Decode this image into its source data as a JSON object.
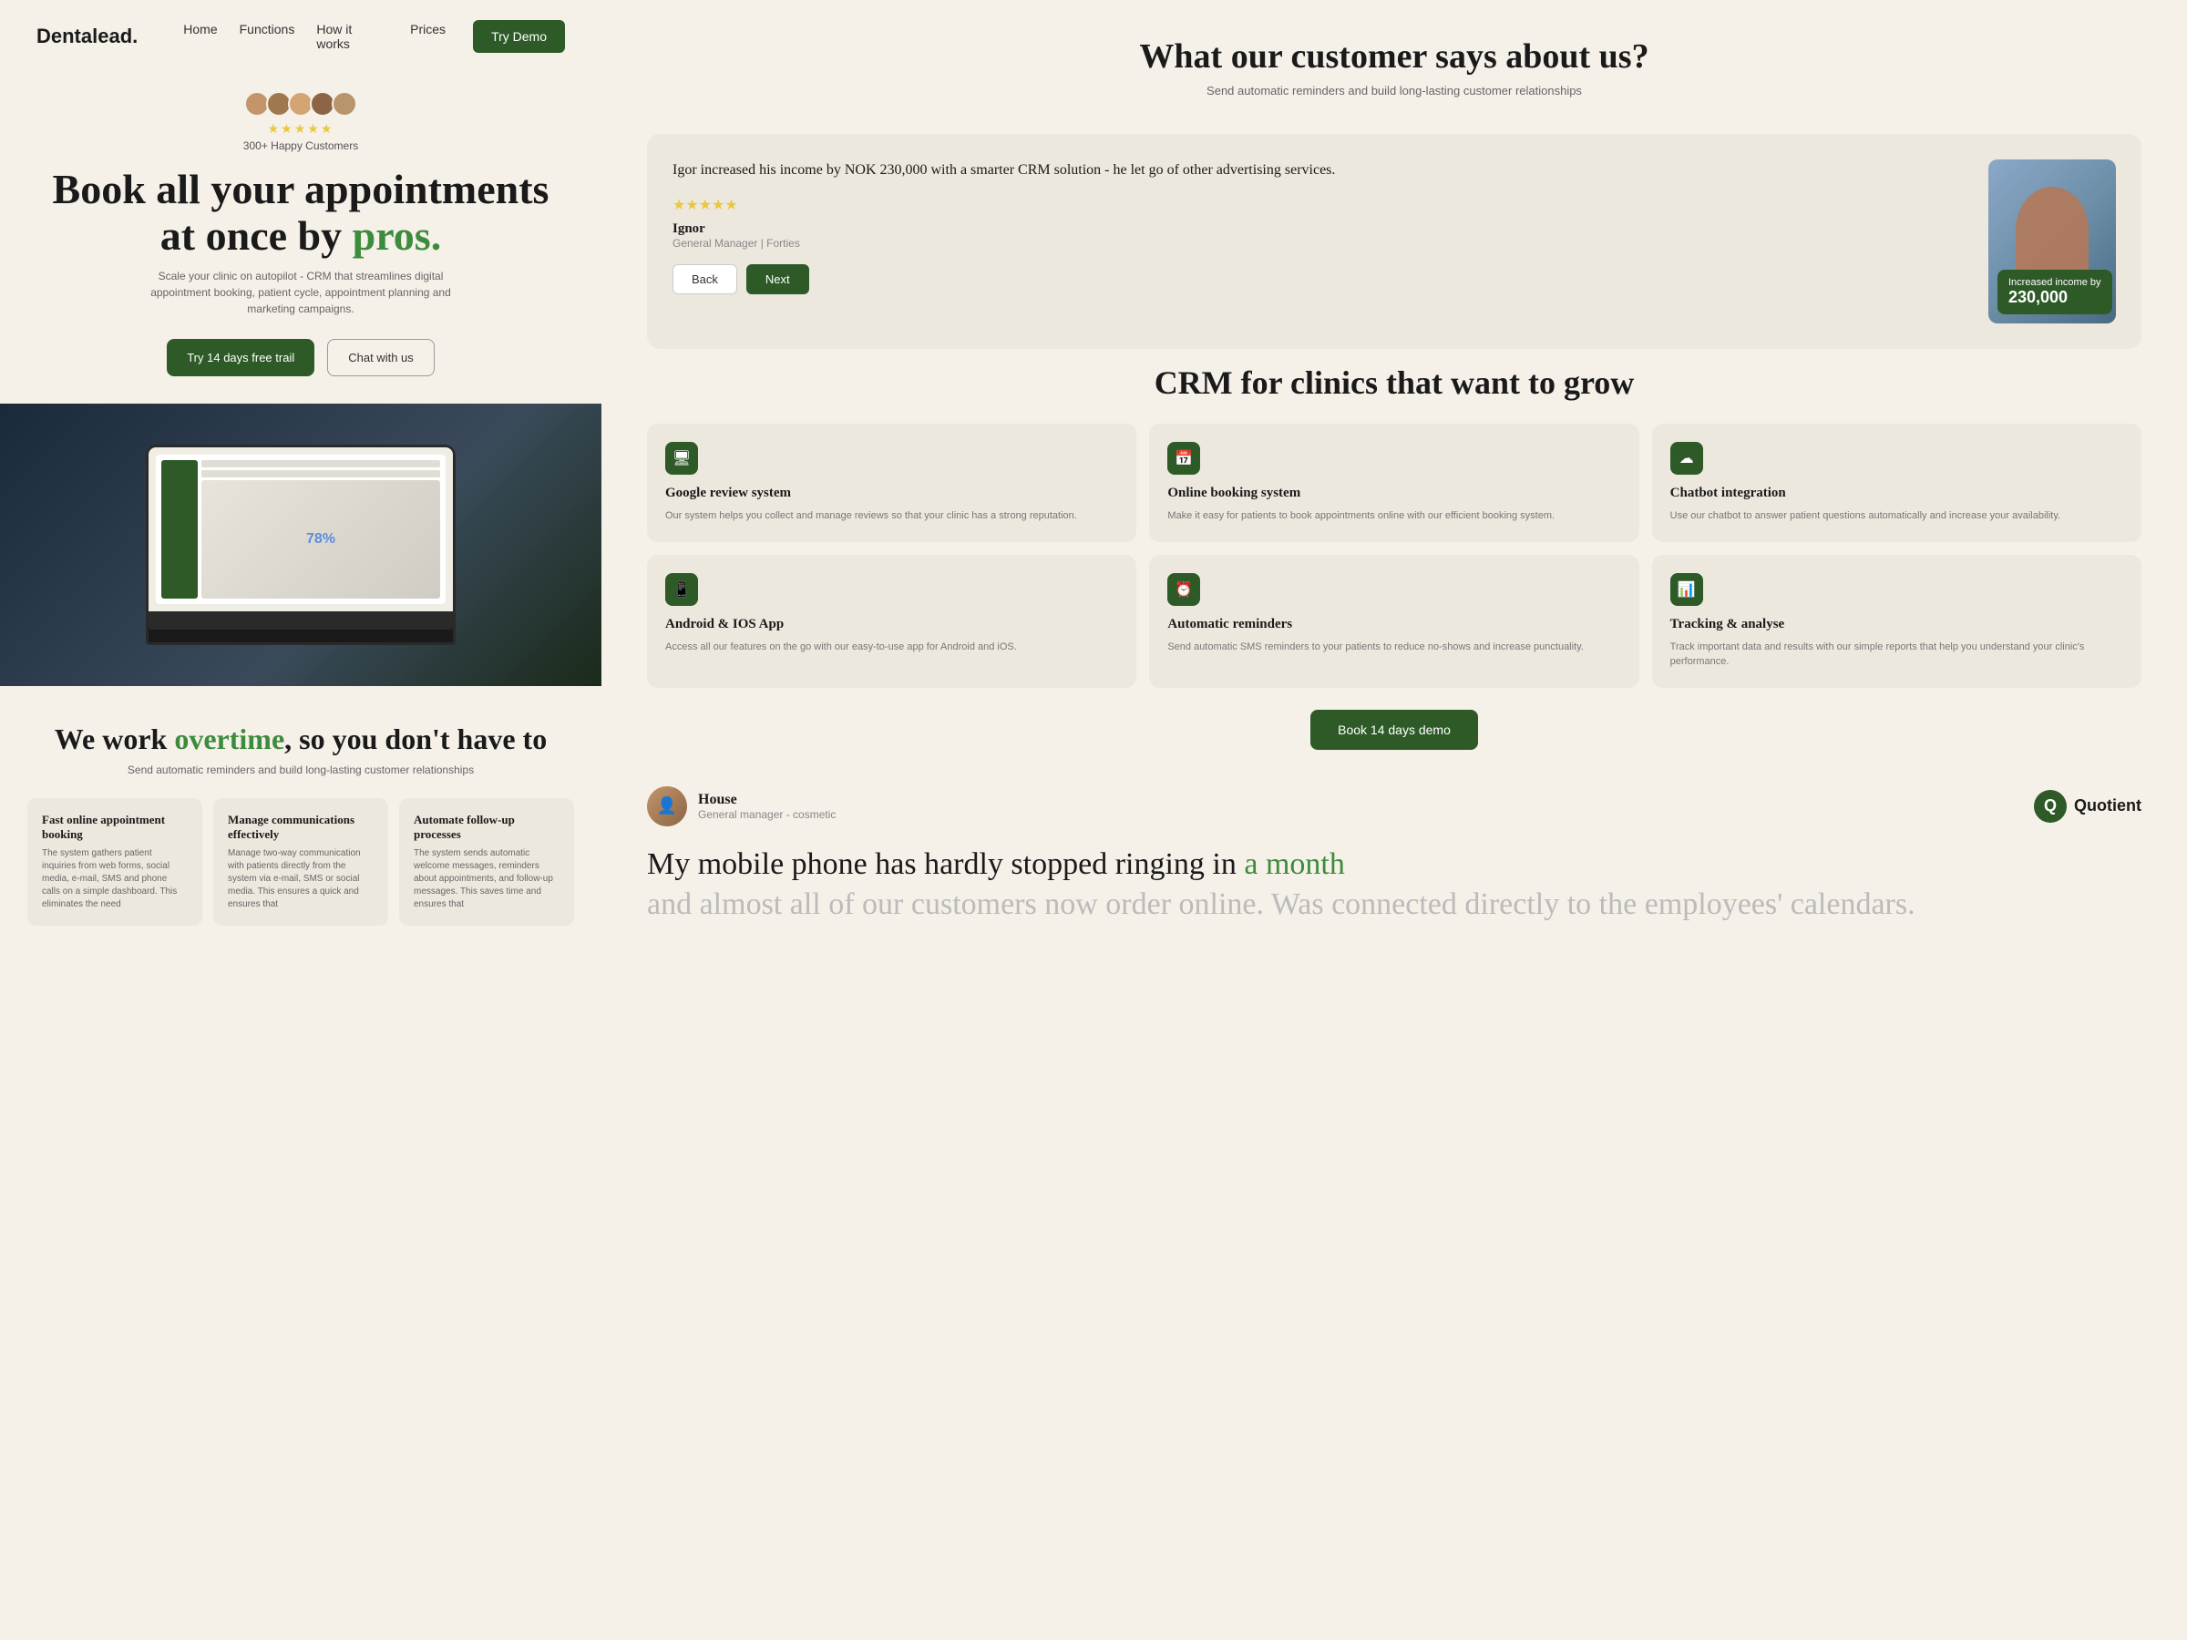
{
  "leftPanel": {
    "nav": {
      "logo": "Dentalead.",
      "links": [
        "Home",
        "Functions",
        "How it works",
        "Prices"
      ],
      "tryBtn": "Try Demo"
    },
    "hero": {
      "avatarCount": 5,
      "stars": "★★★★★",
      "happyCustomers": "300+ Happy Customers",
      "titleLine1": "Book all your appointments",
      "titleLine2": "at once by ",
      "titleAccent": "pros.",
      "subtitle": "Scale your clinic on autopilot - CRM that streamlines digital appointment booking, patient cycle, appointment planning and marketing campaigns.",
      "btnPrimary": "Try 14 days free trail",
      "btnSecondary": "Chat with us"
    },
    "workSection": {
      "title1": "We work ",
      "titleAccent": "overtime",
      "title2": ", so you don't have to",
      "subtitle": "Send automatic reminders and build long-lasting customer relationships",
      "features": [
        {
          "title": "Fast online appointment booking",
          "desc": "The system gathers patient inquiries from web forms, social media, e-mail, SMS and phone calls on a simple dashboard. This eliminates the need"
        },
        {
          "title": "Manage communications effectively",
          "desc": "Manage two-way communication with patients directly from the system via e-mail, SMS or social media. This ensures a quick and ensures that"
        },
        {
          "title": "Automate follow-up processes",
          "desc": "The system sends automatic welcome messages, reminders about appointments, and follow-up messages. This saves time and ensures that"
        }
      ]
    }
  },
  "rightPanel": {
    "customerSection": {
      "title": "What our customer says about us?",
      "subtitle": "Send automatic reminders and build long-lasting customer relationships"
    },
    "testimonial": {
      "text": "Igor increased his income by NOK 230,000 with a smarter CRM solution - he let go of other advertising services.",
      "stars": "★★★★★",
      "name": "Ignor",
      "role": "General Manager | Forties",
      "backBtn": "Back",
      "nextBtn": "Next",
      "incomeBadgeLabel": "Increased income by",
      "incomeBadgeAmount": "230,000"
    },
    "crmSection": {
      "title": "CRM for clinics that want to grow",
      "cards": [
        {
          "icon": "🖥",
          "title": "Google review system",
          "desc": "Our system helps you collect and manage reviews so that your clinic has a strong reputation."
        },
        {
          "icon": "📅",
          "title": "Online booking system",
          "desc": "Make it easy for patients to book appointments online with our efficient booking system."
        },
        {
          "icon": "☁",
          "title": "Chatbot integration",
          "desc": "Use our chatbot to answer patient questions automatically and increase your availability."
        },
        {
          "icon": "📱",
          "title": "Android & IOS App",
          "desc": "Access all our features on the go with our easy-to-use app for Android and iOS."
        },
        {
          "icon": "⏰",
          "title": "Automatic reminders",
          "desc": "Send automatic SMS reminders to your patients to reduce no-shows and increase punctuality."
        },
        {
          "icon": "📊",
          "title": "Tracking & analyse",
          "desc": "Track important data and results with our simple reports that help you understand your clinic's performance."
        }
      ],
      "demoBtn": "Book 14 days demo"
    },
    "quoteSection": {
      "personName": "House",
      "personRole": "General manager - cosmetic",
      "brandName": "Quotient",
      "quote1": "My mobile phone has hardly stopped ringing in ",
      "quote1Accent": "a month",
      "quote2Faded": "and almost all of our customers now order online. Was connected directly to the employees' calendars."
    }
  }
}
